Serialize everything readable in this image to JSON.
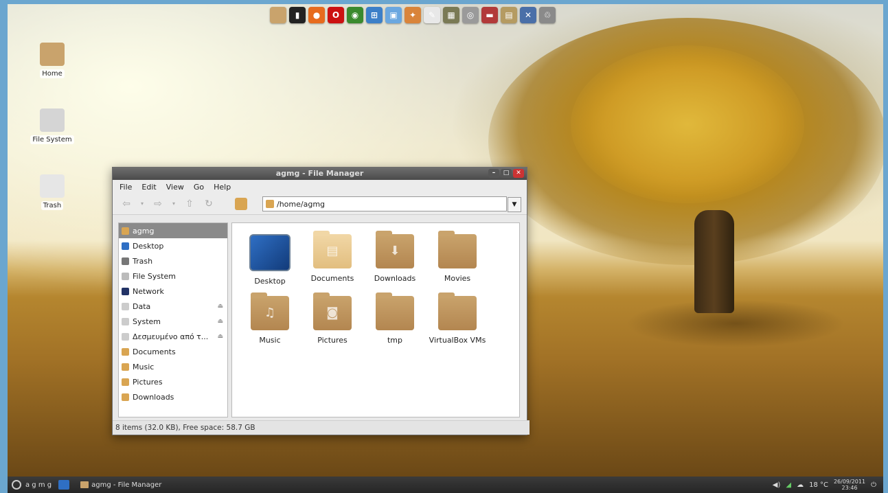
{
  "dock": {
    "icons": [
      {
        "name": "folder-icon",
        "color": "#c9a36c",
        "glyph": ""
      },
      {
        "name": "terminal-icon",
        "color": "#222222",
        "glyph": "▮"
      },
      {
        "name": "firefox-icon",
        "color": "#e76b1e",
        "glyph": "●"
      },
      {
        "name": "opera-icon",
        "color": "#cc1111",
        "glyph": "O"
      },
      {
        "name": "chrome-icon",
        "color": "#3a8a2e",
        "glyph": "◉"
      },
      {
        "name": "app-icon",
        "color": "#3c7fc8",
        "glyph": "⊞"
      },
      {
        "name": "image-viewer-icon",
        "color": "#6aa7e0",
        "glyph": "▣"
      },
      {
        "name": "paint-icon",
        "color": "#d9843a",
        "glyph": "✦"
      },
      {
        "name": "text-editor-icon",
        "color": "#e8e8e8",
        "glyph": "✎"
      },
      {
        "name": "calculator-icon",
        "color": "#7a7a55",
        "glyph": "▦"
      },
      {
        "name": "disc-icon",
        "color": "#9a9a9a",
        "glyph": "◎"
      },
      {
        "name": "toolbox-icon",
        "color": "#b23a3a",
        "glyph": "▬"
      },
      {
        "name": "package-icon",
        "color": "#b59b62",
        "glyph": "▤"
      },
      {
        "name": "settings-icon",
        "color": "#4a6fa8",
        "glyph": "✕"
      },
      {
        "name": "trash-icon",
        "color": "#8a8a8a",
        "glyph": "♲"
      }
    ]
  },
  "desktop": {
    "icons": [
      {
        "label": "Home",
        "icon": "home-folder-icon",
        "color": "#c9a36c"
      },
      {
        "label": "File System",
        "icon": "drive-icon",
        "color": "#d5d5d5"
      },
      {
        "label": "Trash",
        "icon": "trash-icon",
        "color": "#e6e6e6"
      }
    ]
  },
  "window": {
    "title": "agmg - File Manager",
    "menu": [
      "File",
      "Edit",
      "View",
      "Go",
      "Help"
    ],
    "address": "/home/agmg",
    "sidebar": [
      {
        "label": "agmg",
        "icon": "home-icon",
        "color": "#d9a552",
        "selected": true
      },
      {
        "label": "Desktop",
        "icon": "desktop-icon",
        "color": "#2f6fc4"
      },
      {
        "label": "Trash",
        "icon": "trash-icon",
        "color": "#777777"
      },
      {
        "label": "File System",
        "icon": "drive-icon",
        "color": "#bbbbbb"
      },
      {
        "label": "Network",
        "icon": "network-icon",
        "color": "#223366"
      },
      {
        "label": "Data",
        "icon": "drive-icon",
        "color": "#cccccc",
        "eject": true
      },
      {
        "label": "System",
        "icon": "drive-icon",
        "color": "#cccccc",
        "eject": true
      },
      {
        "label": "Δεσμευμένο από τ...",
        "icon": "drive-icon",
        "color": "#cccccc",
        "eject": true
      },
      {
        "label": "Documents",
        "icon": "folder-icon",
        "color": "#d9a552"
      },
      {
        "label": "Music",
        "icon": "folder-icon",
        "color": "#d9a552"
      },
      {
        "label": "Pictures",
        "icon": "folder-icon",
        "color": "#d9a552"
      },
      {
        "label": "Downloads",
        "icon": "folder-icon",
        "color": "#d9a552"
      }
    ],
    "files": [
      {
        "label": "Desktop",
        "type": "desktop",
        "glyph": ""
      },
      {
        "label": "Documents",
        "type": "docs",
        "glyph": "▤"
      },
      {
        "label": "Downloads",
        "type": "folder",
        "glyph": "⬇"
      },
      {
        "label": "Movies",
        "type": "folder",
        "glyph": ""
      },
      {
        "label": "Music",
        "type": "folder",
        "glyph": "♫"
      },
      {
        "label": "Pictures",
        "type": "folder",
        "glyph": "◙"
      },
      {
        "label": "tmp",
        "type": "folder",
        "glyph": ""
      },
      {
        "label": "VirtualBox VMs",
        "type": "folder",
        "glyph": ""
      }
    ],
    "status": "8 items (32.0 KB), Free space: 58.7 GB"
  },
  "taskbar": {
    "user": "a g m g",
    "task": "agmg - File Manager",
    "weather": "18 °C",
    "date": "26/09/2011",
    "time": "23:46"
  }
}
